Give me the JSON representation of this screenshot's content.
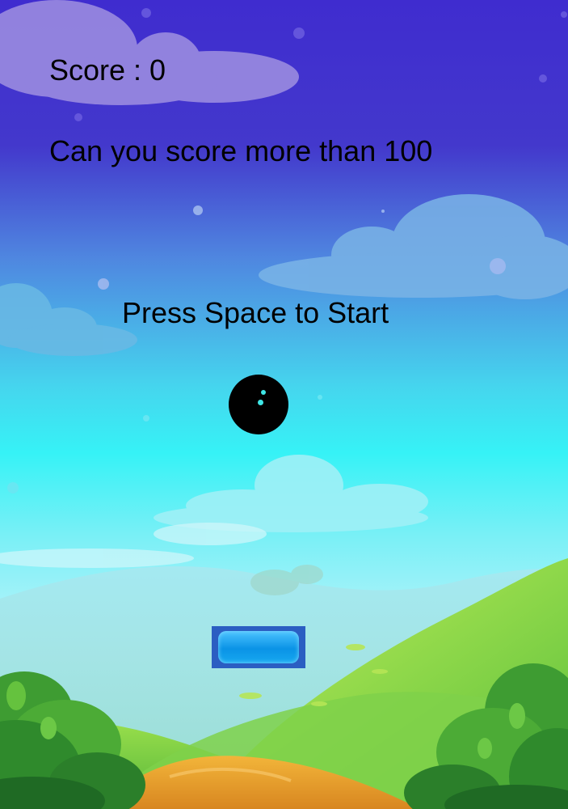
{
  "hud": {
    "score_text": "Score : 0",
    "challenge_text": "Can you score more than 100",
    "start_prompt": "Press Space to Start"
  },
  "colors": {
    "sky_top": "#3f2ccf",
    "sky_mid": "#4fb4f0",
    "sky_low": "#3ef0f4",
    "hill_light": "#9ee24a",
    "hill_dark": "#3f9a2d",
    "path": "#e49a2c",
    "ball": "#000000",
    "paddle": "#1fa4f0",
    "text": "#000000"
  },
  "icons": {
    "ball": "ball",
    "paddle": "paddle"
  }
}
